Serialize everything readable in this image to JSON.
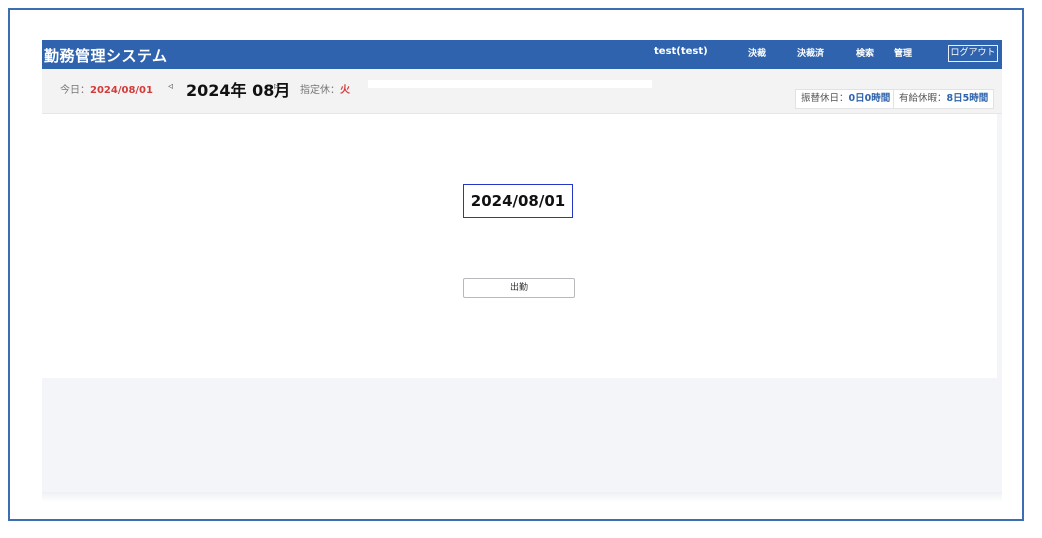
{
  "header": {
    "app_title": "勤務管理システム",
    "user": "test(test)",
    "nav": [
      "決裁",
      "決裁済",
      "検索",
      "管理"
    ],
    "logout_label": "ログアウト",
    "color": "#2f63ad"
  },
  "toolbar": {
    "today_label": "今日：",
    "today_value": "2024/08/01",
    "prev_arrow": "◃",
    "month_label": "2024年 08月",
    "next_arrow": "▹",
    "holiday_label": "指定休：",
    "holiday_value": "火",
    "substitute_leave_label": "振替休日：",
    "substitute_leave_value": "0日0時間",
    "paid_leave_label": "有給休暇：",
    "paid_leave_value": "8日5時間"
  },
  "main": {
    "date_display": "2024/08/01",
    "clock_in_label": "出勤"
  }
}
